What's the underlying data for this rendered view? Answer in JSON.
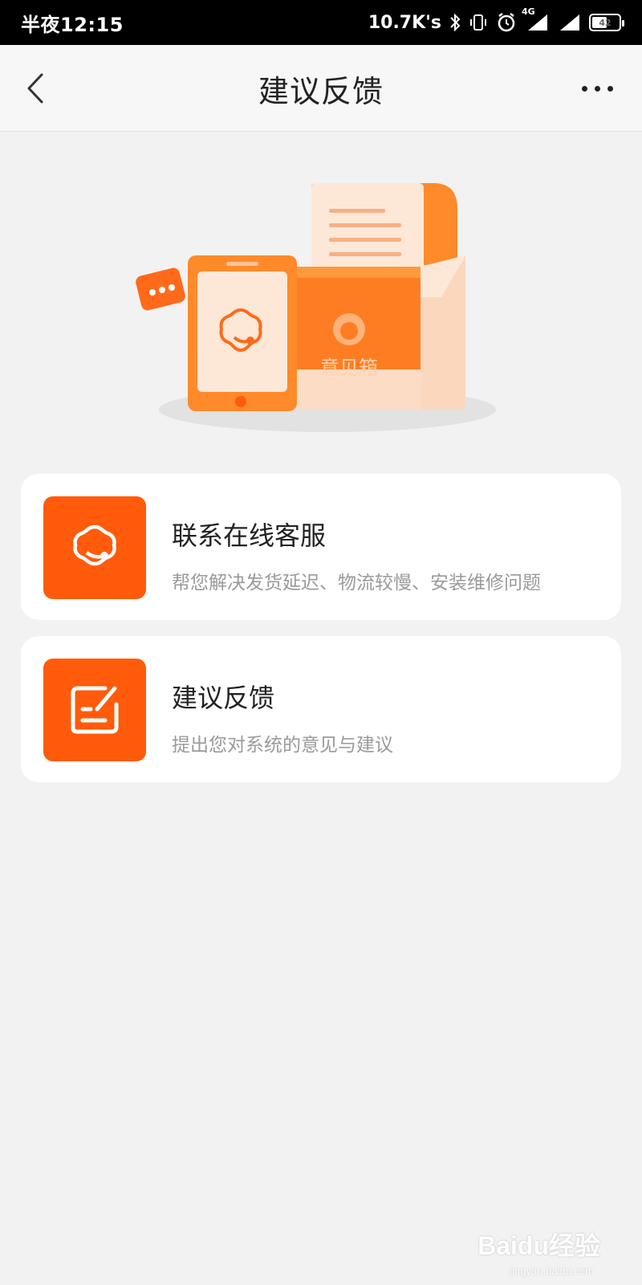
{
  "status_bar": {
    "time": "半夜12:15",
    "net_speed": "10.7K's",
    "network_type": "4G",
    "battery_level": "42",
    "icons": [
      "bluetooth-icon",
      "vibrate-icon",
      "alarm-icon",
      "signal-icon",
      "wifi-icon",
      "battery-icon"
    ]
  },
  "nav": {
    "title": "建议反馈",
    "back_icon": "chevron-left-icon",
    "more_icon": "more-dots-icon"
  },
  "hero": {
    "box_label": "意见箱",
    "colors": {
      "orange": "#ff6a1a",
      "light_orange": "#ff9a3c",
      "paper": "#fde8d8"
    }
  },
  "cards": [
    {
      "title": "联系在线客服",
      "subtitle": "帮您解决发货延迟、物流较慢、安装维修问题",
      "icon": "customer-service-icon"
    },
    {
      "title": "建议反馈",
      "subtitle": "提出您对系统的意见与建议",
      "icon": "edit-note-icon"
    }
  ],
  "theme": {
    "accent": "#ff5b0a",
    "background": "#f2f2f2"
  },
  "watermark": {
    "brand": "Baidu经验",
    "url": "jingyan.baidu.com"
  }
}
